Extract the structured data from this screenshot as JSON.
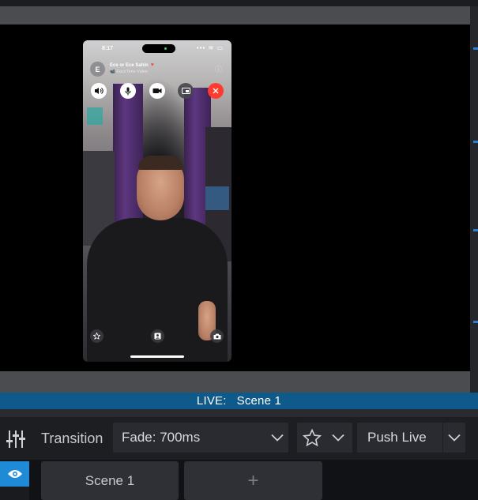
{
  "phone": {
    "status_time": "8:17",
    "status_icons": "▪▪▪ ≋ ▭",
    "caller_initial": "E",
    "caller_name": "Ece or Ece Sahin 🔻",
    "caller_sub": "📹 FaceTime Video",
    "info_icon": "ⓘ"
  },
  "live_bar": {
    "label": "LIVE:",
    "scene": "Scene 1"
  },
  "transition": {
    "label": "Transition",
    "selected": "Fade: 700ms",
    "push_label": "Push Live"
  },
  "scenes": {
    "items": [
      "Scene 1"
    ],
    "add_label": "+"
  },
  "colors": {
    "accent": "#1f8ad6",
    "live_bar": "#0e5a8a",
    "end_call": "#ff3b30"
  }
}
